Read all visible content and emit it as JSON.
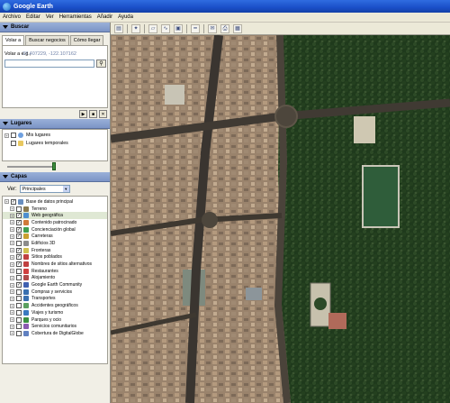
{
  "window": {
    "title": "Google Earth"
  },
  "menu": [
    "Archivo",
    "Editar",
    "Ver",
    "Herramientas",
    "Añadir",
    "Ayuda"
  ],
  "search_panel": {
    "title": "Buscar",
    "tabs": [
      "Volar a",
      "Buscar negocios",
      "Cómo llegar"
    ],
    "fly_label": "Volar a e.g.,",
    "fly_hint": "37.407229, -122.107162",
    "fly_input_value": ""
  },
  "places_panel": {
    "title": "Lugares",
    "items": [
      {
        "label": "Mis lugares",
        "icon": "globe-icon"
      },
      {
        "label": "Lugares temporales",
        "icon": "folder-icon"
      }
    ]
  },
  "layers_panel": {
    "title": "Capas",
    "view_label": "Ver:",
    "view_value": "Principales",
    "items": [
      {
        "label": "Base de datos principal",
        "checked": true,
        "selected": false,
        "indent": false
      },
      {
        "label": "Terreno",
        "checked": false,
        "selected": false,
        "indent": true
      },
      {
        "label": "Web geográfica",
        "checked": true,
        "selected": true,
        "indent": true
      },
      {
        "label": "Contenido patrocinado",
        "checked": true,
        "selected": false,
        "indent": true
      },
      {
        "label": "Concienciación global",
        "checked": true,
        "selected": false,
        "indent": true
      },
      {
        "label": "Carreteras",
        "checked": true,
        "selected": false,
        "indent": true
      },
      {
        "label": "Edificios 3D",
        "checked": false,
        "selected": false,
        "indent": true
      },
      {
        "label": "Fronteras",
        "checked": true,
        "selected": false,
        "indent": true
      },
      {
        "label": "Sitios poblados",
        "checked": true,
        "selected": false,
        "indent": true
      },
      {
        "label": "Nombres de sitios alternativos",
        "checked": true,
        "selected": false,
        "indent": true
      },
      {
        "label": "Restaurantes",
        "checked": false,
        "selected": false,
        "indent": true
      },
      {
        "label": "Alojamiento",
        "checked": false,
        "selected": false,
        "indent": true
      },
      {
        "label": "Google Earth Community",
        "checked": true,
        "selected": false,
        "indent": true
      },
      {
        "label": "Compras y servicios",
        "checked": false,
        "selected": false,
        "indent": true
      },
      {
        "label": "Transportes",
        "checked": false,
        "selected": false,
        "indent": true
      },
      {
        "label": "Accidentes geográficos",
        "checked": false,
        "selected": false,
        "indent": true
      },
      {
        "label": "Viajes y turismo",
        "checked": false,
        "selected": false,
        "indent": true
      },
      {
        "label": "Parques y ocio",
        "checked": false,
        "selected": false,
        "indent": true
      },
      {
        "label": "Servicios comunitarios",
        "checked": false,
        "selected": false,
        "indent": true
      },
      {
        "label": "Cobertura de DigitalGlobe",
        "checked": false,
        "selected": false,
        "indent": true
      }
    ]
  },
  "colors": {
    "title_bar": "#1a4fc8",
    "panel_header": "#8aa2d0",
    "selection": "#dfe8d4",
    "map_park": "#1f3a1c",
    "pond": "#2f5d3a"
  }
}
